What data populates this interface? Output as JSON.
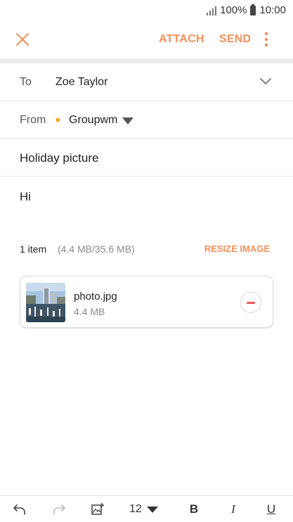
{
  "status_bar": {
    "battery": "100%",
    "time": "10:00"
  },
  "action_bar": {
    "attach_label": "ATTACH",
    "send_label": "SEND"
  },
  "compose": {
    "to_label": "To",
    "to_value": "Zoe Taylor",
    "from_label": "From",
    "from_value": "Groupwm",
    "subject": "Holiday picture",
    "body": "Hi"
  },
  "attachments": {
    "count_text": "1 item",
    "size_text": "(4.4 MB/35.6 MB)",
    "resize_label": "RESIZE IMAGE",
    "items": [
      {
        "name": "photo.jpg",
        "size": "4.4 MB"
      }
    ]
  },
  "toolbar": {
    "font_size": "12",
    "bold": "B",
    "italic": "I",
    "underline": "U"
  },
  "colors": {
    "accent": "#f4905a",
    "remove": "#f05a5a",
    "account_dot": "#f5a623"
  }
}
